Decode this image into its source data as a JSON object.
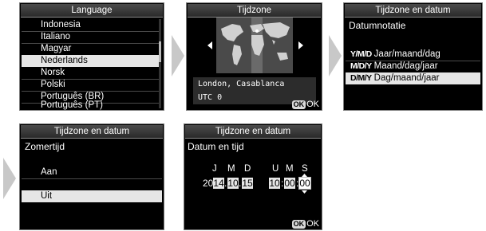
{
  "language_screen": {
    "title": "Language",
    "items": [
      {
        "label": "Indonesia"
      },
      {
        "label": "Italiano"
      },
      {
        "label": "Magyar"
      },
      {
        "label": "Nederlands",
        "selected": true
      },
      {
        "label": "Norsk"
      },
      {
        "label": "Polski"
      },
      {
        "label": "Português (BR)"
      },
      {
        "label": "Português (PT)"
      }
    ]
  },
  "timezone_screen": {
    "title": "Tijdzone",
    "city": "London, Casablanca",
    "utc": "UTC 0",
    "ok_badge": "OK",
    "ok_label": "OK"
  },
  "dateformat_screen": {
    "title": "Tijdzone en datum",
    "subtitle": "Datumnotatie",
    "options": [
      {
        "code": "Y/M/D",
        "label": "Jaar/maand/dag"
      },
      {
        "code": "M/D/Y",
        "label": "Maand/dag/jaar"
      },
      {
        "code": "D/M/Y",
        "label": "Dag/maand/jaar",
        "selected": true
      }
    ]
  },
  "dst_screen": {
    "title": "Tijdzone en datum",
    "subtitle": "Zomertijd",
    "options": [
      {
        "label": "Aan"
      },
      {
        "label": "Uit",
        "selected": true
      }
    ]
  },
  "datetime_screen": {
    "title": "Tijdzone en datum",
    "subtitle": "Datum en tijd",
    "headers": [
      "J",
      "M",
      "D",
      "U",
      "M",
      "S"
    ],
    "year_prefix": "20",
    "year": "14",
    "month": "10",
    "day": "15",
    "hour": "10",
    "minute": "00",
    "second": "00",
    "sep_date": ".",
    "sep_time": ":",
    "ok_badge": "OK",
    "ok_label": "OK"
  },
  "colors": {
    "screen_bg": "#000000",
    "highlight": "#e6e6e6",
    "arrow": "#c8c8c8"
  }
}
